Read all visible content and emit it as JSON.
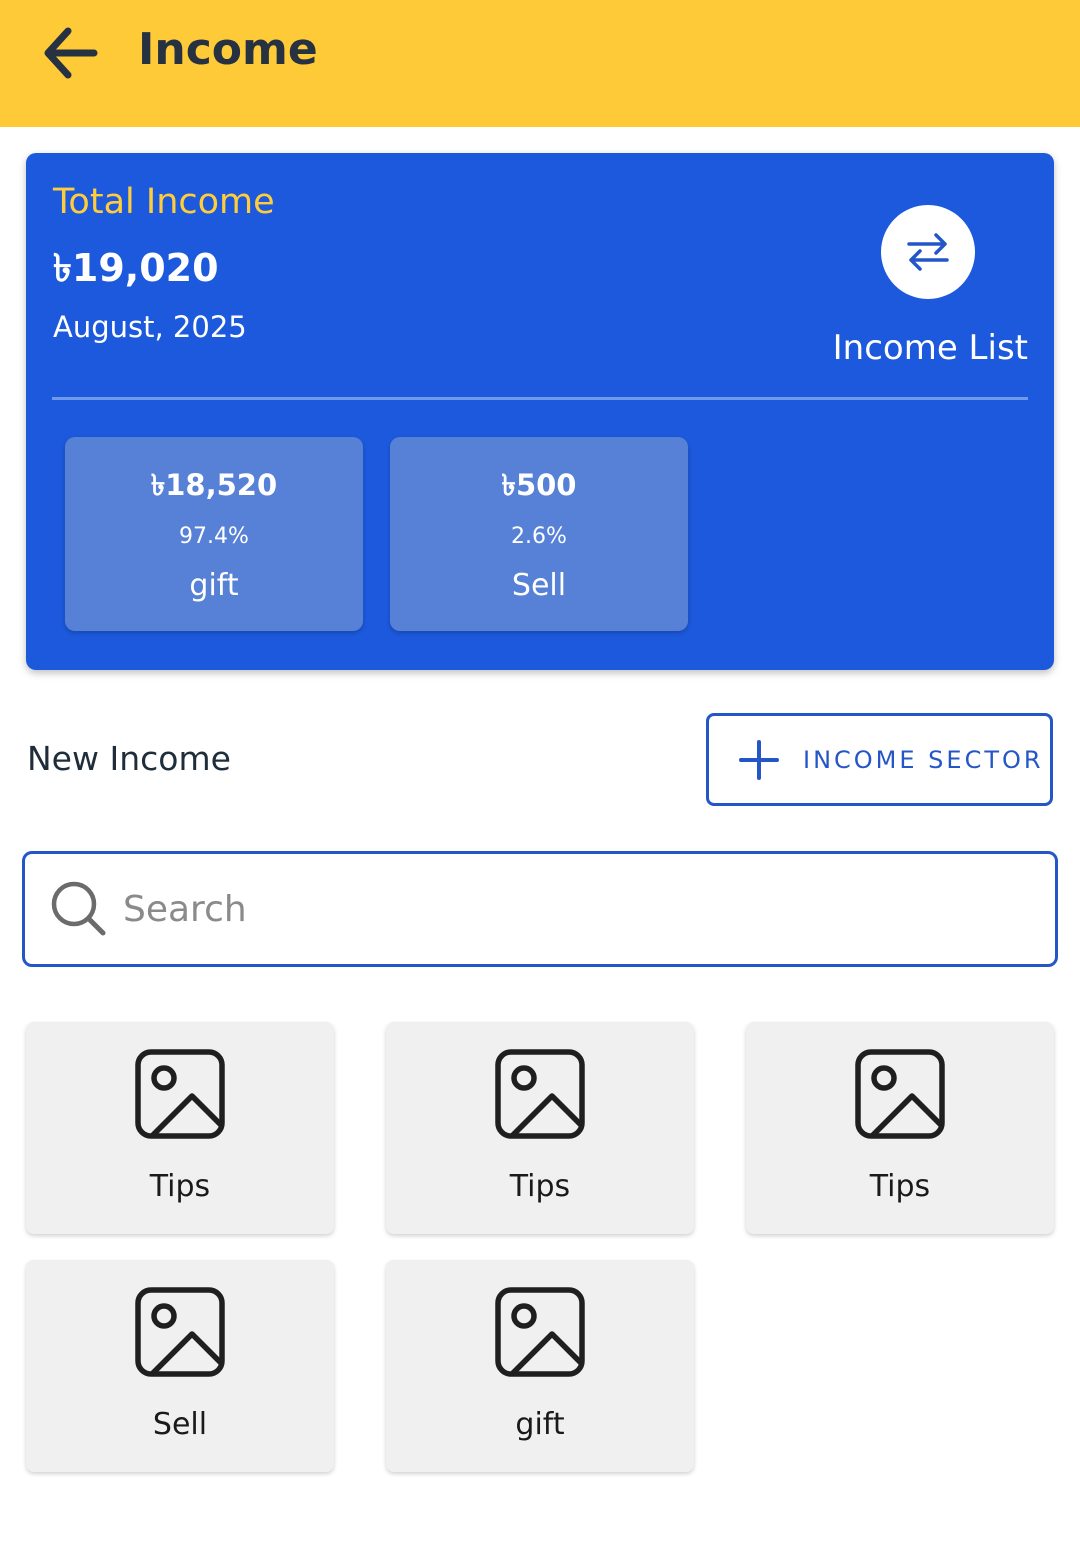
{
  "appbar": {
    "title": "Income",
    "back_icon": "arrow-left-icon"
  },
  "summary": {
    "label": "Total Income",
    "amount": "৳19,020",
    "month": "August, 2025",
    "list_button_icon": "swap-arrows-icon",
    "list_label": "Income List",
    "stats": [
      {
        "amount": "৳18,520",
        "percent": "97.4%",
        "name": "gift"
      },
      {
        "amount": "৳500",
        "percent": "2.6%",
        "name": "Sell"
      }
    ]
  },
  "new_income": {
    "label": "New Income",
    "sector_button": "INCOME SECTOR",
    "sector_icon": "plus-icon"
  },
  "search": {
    "placeholder": "Search",
    "value": "",
    "icon": "search-icon"
  },
  "categories": [
    {
      "label": "Tips",
      "icon": "image-placeholder-icon"
    },
    {
      "label": "Tips",
      "icon": "image-placeholder-icon"
    },
    {
      "label": "Tips",
      "icon": "image-placeholder-icon"
    },
    {
      "label": "Sell",
      "icon": "image-placeholder-icon"
    },
    {
      "label": "gift",
      "icon": "image-placeholder-icon"
    }
  ],
  "colors": {
    "appbar": "#ffca38",
    "card": "#1c59dc",
    "accent_yellow": "#ffcd3b",
    "primary_blue": "#2456c8"
  }
}
